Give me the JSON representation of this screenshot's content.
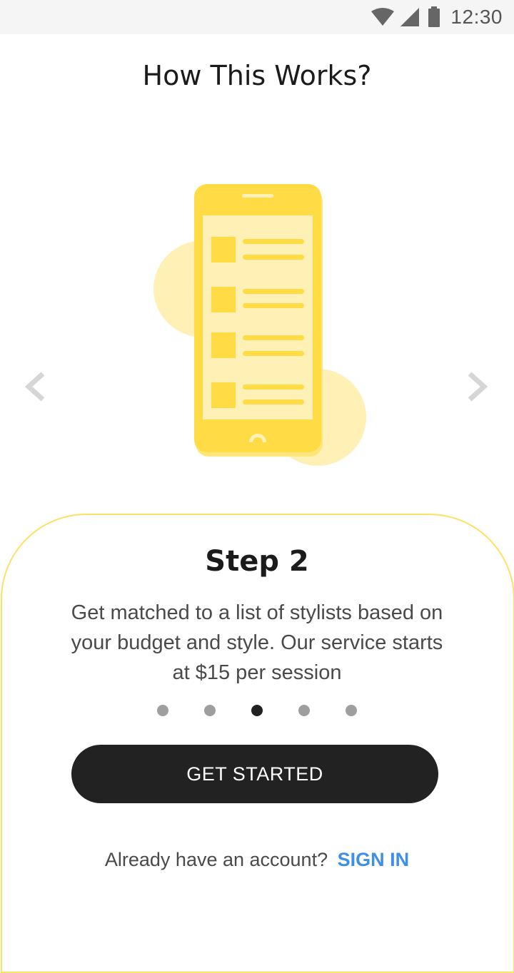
{
  "status_bar": {
    "time": "12:30",
    "icons": [
      "wifi-icon",
      "cell-signal-icon",
      "battery-icon"
    ]
  },
  "page": {
    "title": "How This Works?"
  },
  "illustration": {
    "name": "phone-list-illustration",
    "colors": {
      "phone": "#ffdc46",
      "screen": "#fff0b5",
      "blob": "#fff0b5"
    }
  },
  "carousel": {
    "prev_icon": "chevron-left-icon",
    "next_icon": "chevron-right-icon",
    "step_title": "Step 2",
    "step_description": "Get matched to a list of stylists based on your budget and style. Our service starts at $15 per session",
    "page_count": 5,
    "active_index": 2
  },
  "cta": {
    "label": "GET STARTED",
    "color": "#222222"
  },
  "signin": {
    "prompt": "Already have an account?",
    "link_label": "SIGN IN",
    "link_color": "#3f8fe8"
  },
  "theme": {
    "card_border": "#fde066"
  }
}
